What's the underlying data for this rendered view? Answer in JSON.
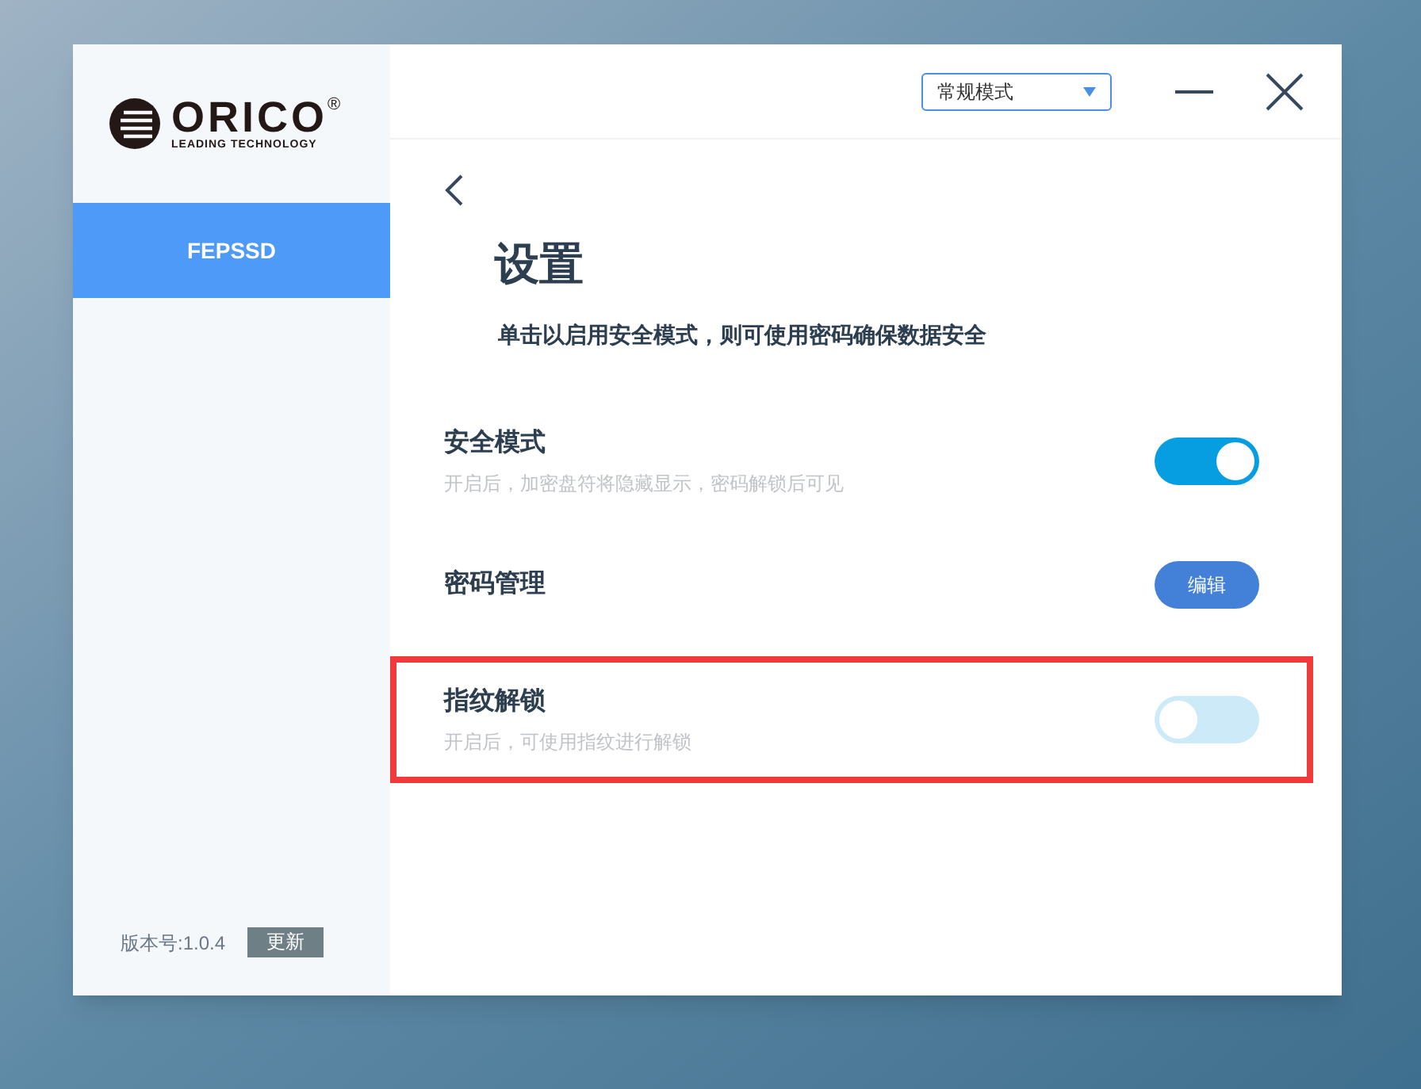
{
  "logo": {
    "brand": "ORICO",
    "mark": "®",
    "tagline": "LEADING TECHNOLOGY"
  },
  "sidebar": {
    "items": [
      {
        "label": "FEPSSD",
        "selected": true
      }
    ],
    "version": "版本号:1.0.4",
    "update_button": "更新"
  },
  "header": {
    "mode_select": {
      "value": "常规模式"
    }
  },
  "page": {
    "title": "设置",
    "subtitle": "单击以启用安全模式，则可使用密码确保数据安全",
    "settings": [
      {
        "kind": "toggle",
        "label": "安全模式",
        "description": "开启后，加密盘符将隐藏显示，密码解锁后可见",
        "on": true,
        "highlighted": false
      },
      {
        "kind": "button",
        "label": "密码管理",
        "button": "编辑",
        "highlighted": false
      },
      {
        "kind": "toggle",
        "label": "指纹解锁",
        "description": "开启后，可使用指纹进行解锁",
        "on": false,
        "highlighted": true
      }
    ]
  }
}
